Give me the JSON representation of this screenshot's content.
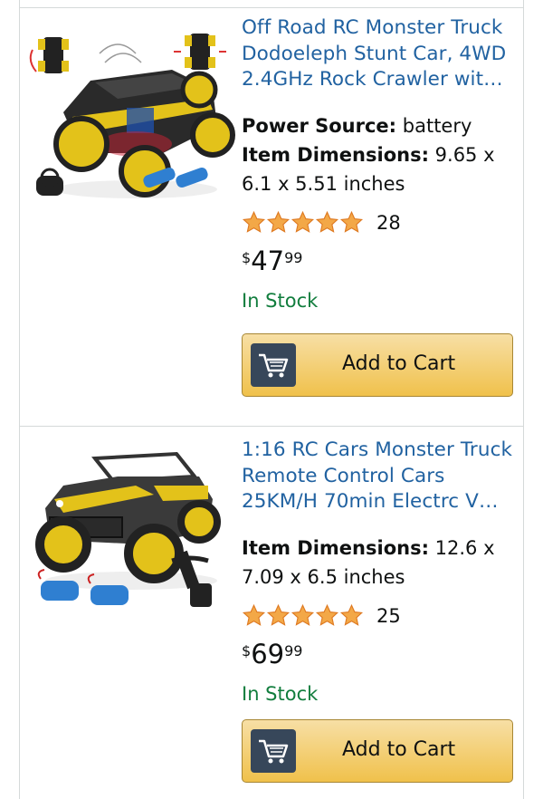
{
  "products": [
    {
      "title": "Off Road RC Monster Truck Dodoeleph Stunt Car, 4WD 2.4GHz Rock Crawler wit…",
      "title_lines": [
        "Off Road RC Monster Truck",
        "Dodoeleph Stunt Car, 4WD",
        "2.4GHz Rock Crawler wit…"
      ],
      "power_source_label": "Power Source:",
      "power_source_value": "battery",
      "dimensions_label": "Item Dimensions:",
      "dimensions_value_line1": "9.65 x",
      "dimensions_value_line2": "6.1 x 5.51 inches",
      "rating": 5,
      "rating_count": "28",
      "price_symbol": "$",
      "price_whole": "47",
      "price_fraction": "99",
      "stock": "In Stock",
      "add_to_cart": "Add to Cart",
      "image_icon": "stunt-rc-truck-image"
    },
    {
      "title": "1:16 RC Cars Monster Truck Remote Control Cars 25KM/H 70min Electrc V…",
      "title_lines": [
        "1:16 RC Cars Monster Truck",
        "Remote Control Cars",
        "25KM/H 70min Electrc V…"
      ],
      "dimensions_label": "Item Dimensions:",
      "dimensions_value_line1": "12.6 x",
      "dimensions_value_line2": "7.09 x 6.5 inches",
      "rating": 5,
      "rating_count": "25",
      "price_symbol": "$",
      "price_whole": "69",
      "price_fraction": "99",
      "stock": "In Stock",
      "add_to_cart": "Add to Cart",
      "image_icon": "monster-truck-image"
    }
  ],
  "colors": {
    "link": "#2162a1",
    "in_stock": "#117d3d",
    "star": "#f3a847",
    "button": "#f0c14b",
    "cart_icon_bg": "#37475a"
  }
}
